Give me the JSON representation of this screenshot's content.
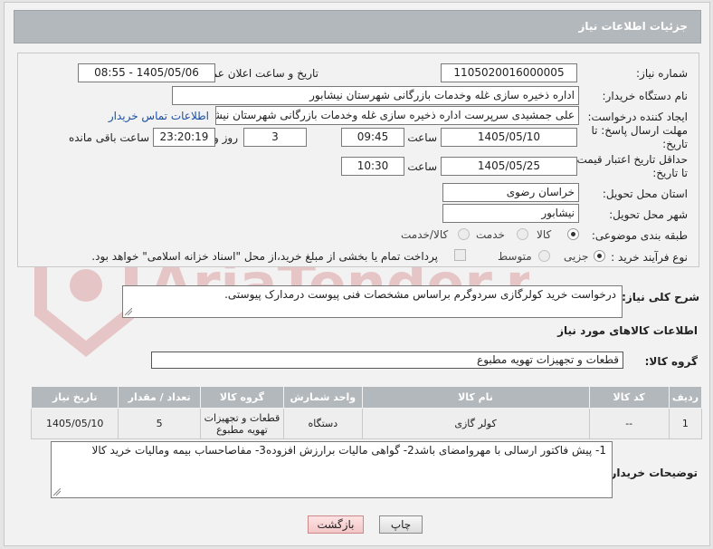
{
  "header": {
    "title": "جزئیات اطلاعات نیاز"
  },
  "form": {
    "need_number_label": "شماره نیاز:",
    "need_number": "1105020016000005",
    "announce_label": "تاریخ و ساعت اعلان عمومی:",
    "announce_value": "1405/05/06 - 08:55",
    "buyer_org_label": "نام دستگاه خریدار:",
    "buyer_org": "اداره ذخیره سازی غله وخدمات بازرگانی شهرستان نیشابور",
    "creator_label": "ایجاد کننده درخواست:",
    "creator": "علی جمشیدی سرپرست اداره ذخیره سازی غله وخدمات بازرگانی شهرستان نیشابور",
    "contact_link": "اطلاعات تماس خریدار",
    "deadline_label_1": "مهلت ارسال پاسخ: تا",
    "deadline_label_2": "تاریخ:",
    "deadline_date": "1405/05/10",
    "time_label": "ساعت",
    "deadline_time": "09:45",
    "days_value": "3",
    "days_label": "روز و",
    "remaining_time": "23:20:19",
    "remaining_label": "ساعت باقی مانده",
    "min_validity_label_1": "حداقل تاریخ اعتبار قیمت:",
    "min_validity_label_2": "تا تاریخ:",
    "validity_date": "1405/05/25",
    "validity_time": "10:30",
    "province_label": "استان محل تحویل:",
    "province": "خراسان رضوی",
    "city_label": "شهر محل تحویل:",
    "city": "نیشابور",
    "category_label": "طبقه بندی موضوعی:",
    "category_options": [
      "کالا",
      "خدمت",
      "کالا/خدمت"
    ],
    "category_selected": "کالا",
    "process_label": "نوع فرآیند خرید :",
    "process_options": [
      "جزیی",
      "متوسط"
    ],
    "process_selected": "جزیی",
    "payment_note": "پرداخت تمام یا بخشی از مبلغ خرید،از محل \"اسناد خزانه اسلامی\" خواهد بود."
  },
  "description": {
    "label": "شرح کلی نیاز:",
    "text": "درخواست خرید کولرگازی سردوگرم براساس مشخصات فنی پیوست درمدارک پیوستی."
  },
  "goods": {
    "section_title": "اطلاعات کالاهای مورد نیاز",
    "group_label": "گروه کالا:",
    "group_value": "قطعات و تجهیزات تهویه مطبوع",
    "columns": [
      "ردیف",
      "کد کالا",
      "نام کالا",
      "واحد شمارش",
      "گروه کالا",
      "تعداد / مقدار",
      "تاریخ نیاز"
    ],
    "rows": [
      [
        "1",
        "--",
        "کولر گازی",
        "دستگاه",
        "قطعات و تجهیزات تهویه مطبوع",
        "5",
        "1405/05/10"
      ]
    ]
  },
  "buyer_notes": {
    "label": "توضیحات خریدار:",
    "text": "1- پیش فاکتور ارسالی با مهروامضای باشد2- گواهی مالیات برارزش افزوده3- مفاصاحساب بیمه ومالیات خرید کالا"
  },
  "buttons": {
    "print": "چاپ",
    "back": "بازگشت"
  },
  "watermark": {
    "text": "AriaTender.neT"
  }
}
